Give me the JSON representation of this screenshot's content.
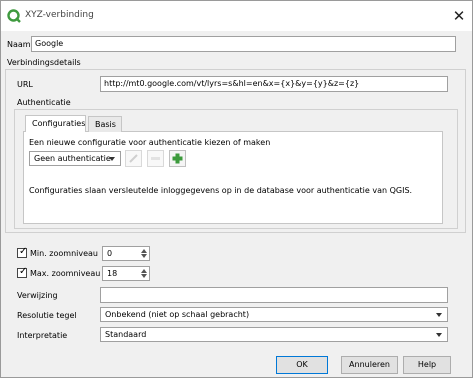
{
  "window": {
    "title": "XYZ-verbinding",
    "close_glyph": "✕"
  },
  "name": {
    "label": "Naam",
    "value": "Google"
  },
  "details": {
    "heading": "Verbindingsdetails"
  },
  "url": {
    "label": "URL",
    "value": "http://mt0.google.com/vt/lyrs=s&hl=en&x={x}&y={y}&z={z}"
  },
  "auth": {
    "heading": "Authenticatie",
    "tabs": [
      "Configuraties",
      "Basis"
    ],
    "instruction": "Een nieuwe configuratie voor authenticatie kiezen of maken",
    "selected": "Geen authenticatie",
    "note": "Configuraties slaan versleutelde inloggegevens op in de database voor authenticatie van QGIS."
  },
  "zoom_min": {
    "label": "Min. zoomniveau",
    "value": "0",
    "checked": true
  },
  "zoom_max": {
    "label": "Max. zoomniveau",
    "value": "18",
    "checked": true
  },
  "referer": {
    "label": "Verwijzing",
    "value": ""
  },
  "resolution": {
    "label": "Resolutie tegel",
    "value": "Onbekend (niet op schaal gebracht)"
  },
  "interpretation": {
    "label": "Interpretatie",
    "value": "Standaard"
  },
  "buttons": {
    "ok": "OK",
    "cancel": "Annuleren",
    "help": "Help"
  },
  "colors": {
    "qgis_green": "#3f9a3f",
    "accent": "#0078d7"
  }
}
